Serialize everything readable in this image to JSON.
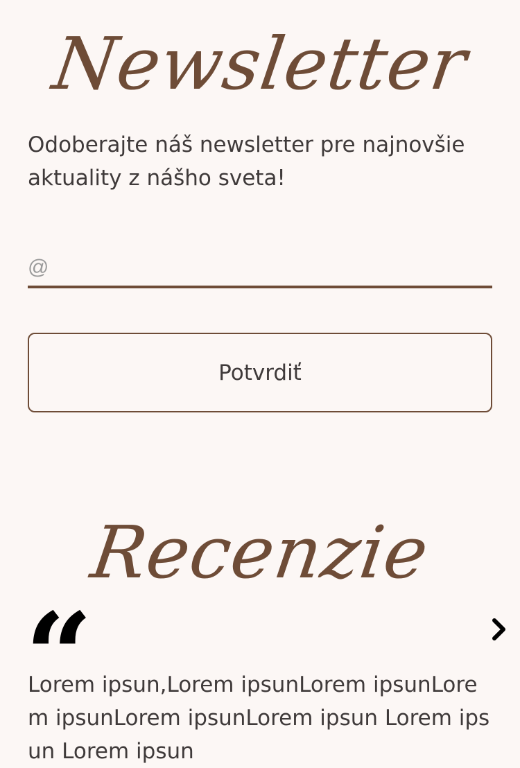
{
  "newsletter": {
    "title": "Newsletter",
    "intro": "Odoberajte náš newsletter pre najnovšie aktuality z nášho sveta!",
    "email_placeholder": "@",
    "submit_label": "Potvrdiť"
  },
  "reviews": {
    "title": "Recenzie",
    "quote_icon": "quote-icon",
    "next_icon": "chevron-right-icon",
    "text": "Lorem ipsun,Lorem ipsunLorem ipsunLorem ipsunLorem ipsunLorem ipsun Lorem ipsun Lorem ipsun"
  },
  "colors": {
    "background": "#fcf7f5",
    "accent": "#6e4c37",
    "text": "#3f3a3a"
  }
}
